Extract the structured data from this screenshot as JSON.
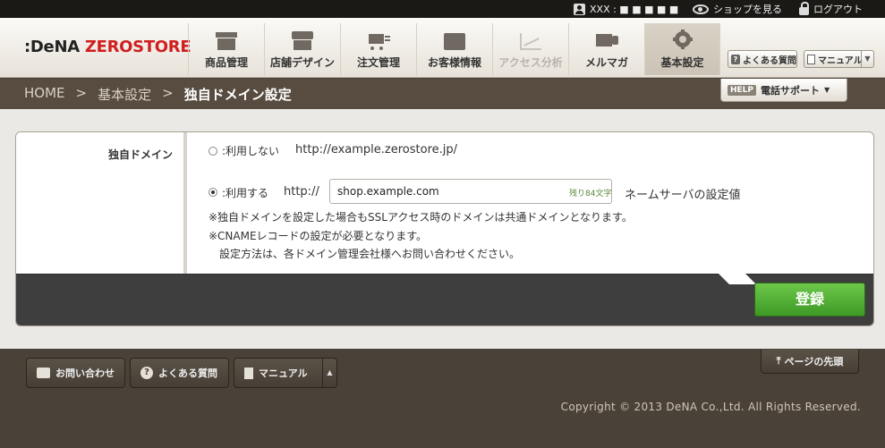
{
  "topbar": {
    "user_label": "XXX : ■ ■ ■ ■ ■",
    "view_shop": "ショップを見る",
    "logout": "ログアウト"
  },
  "logo": {
    "part1": ":DeNA",
    "part2": "ZEROSTORE"
  },
  "nav": [
    {
      "label": "商品管理",
      "icon": "box-icon"
    },
    {
      "label": "店舗デザイン",
      "icon": "store-icon"
    },
    {
      "label": "注文管理",
      "icon": "cart-icon"
    },
    {
      "label": "お客様情報",
      "icon": "customer-card-icon"
    },
    {
      "label": "アクセス分析",
      "icon": "line-graph-icon",
      "disabled": true
    },
    {
      "label": "メルマガ",
      "icon": "mail-icon"
    },
    {
      "label": "基本設定",
      "icon": "gear-icon",
      "active": true
    }
  ],
  "side_buttons": {
    "faq": "よくある質問",
    "manual": "マニュアル"
  },
  "breadcrumb": {
    "home": "HOME",
    "sep": ">",
    "section": "基本設定",
    "current": "独自ドメイン設定"
  },
  "help": {
    "badge": "HELP",
    "label": "電話サポート"
  },
  "form": {
    "row_label": "独自ドメイン",
    "option_off_label": ":利用しない",
    "option_off_url": "http://example.zerostore.jp/",
    "option_on_label": ":利用する",
    "prefix": "http://",
    "domain_value": "shop.example.com",
    "remaining": "残り84文字",
    "nameserver_label": "ネームサーバの設定値",
    "note1": "※独自ドメインを設定した場合もSSLアクセス時のドメインは共通ドメインとなります。",
    "note2": "※CNAMEレコードの設定が必要となります。",
    "note3": "設定方法は、各ドメイン管理会社様へお問い合わせください。",
    "selected": "on"
  },
  "submit_label": "登録",
  "footer": {
    "contact": "お問い合わせ",
    "faq": "よくある質問",
    "manual": "マニュアル",
    "page_top": "ページの先頭",
    "copyright": "Copyright © 2013 DeNA Co.,Ltd. All Rights Reserved."
  },
  "colors": {
    "brand_red": "#cf1f1f",
    "submit_green": "#4caf33",
    "band_brown": "#574c3f"
  }
}
